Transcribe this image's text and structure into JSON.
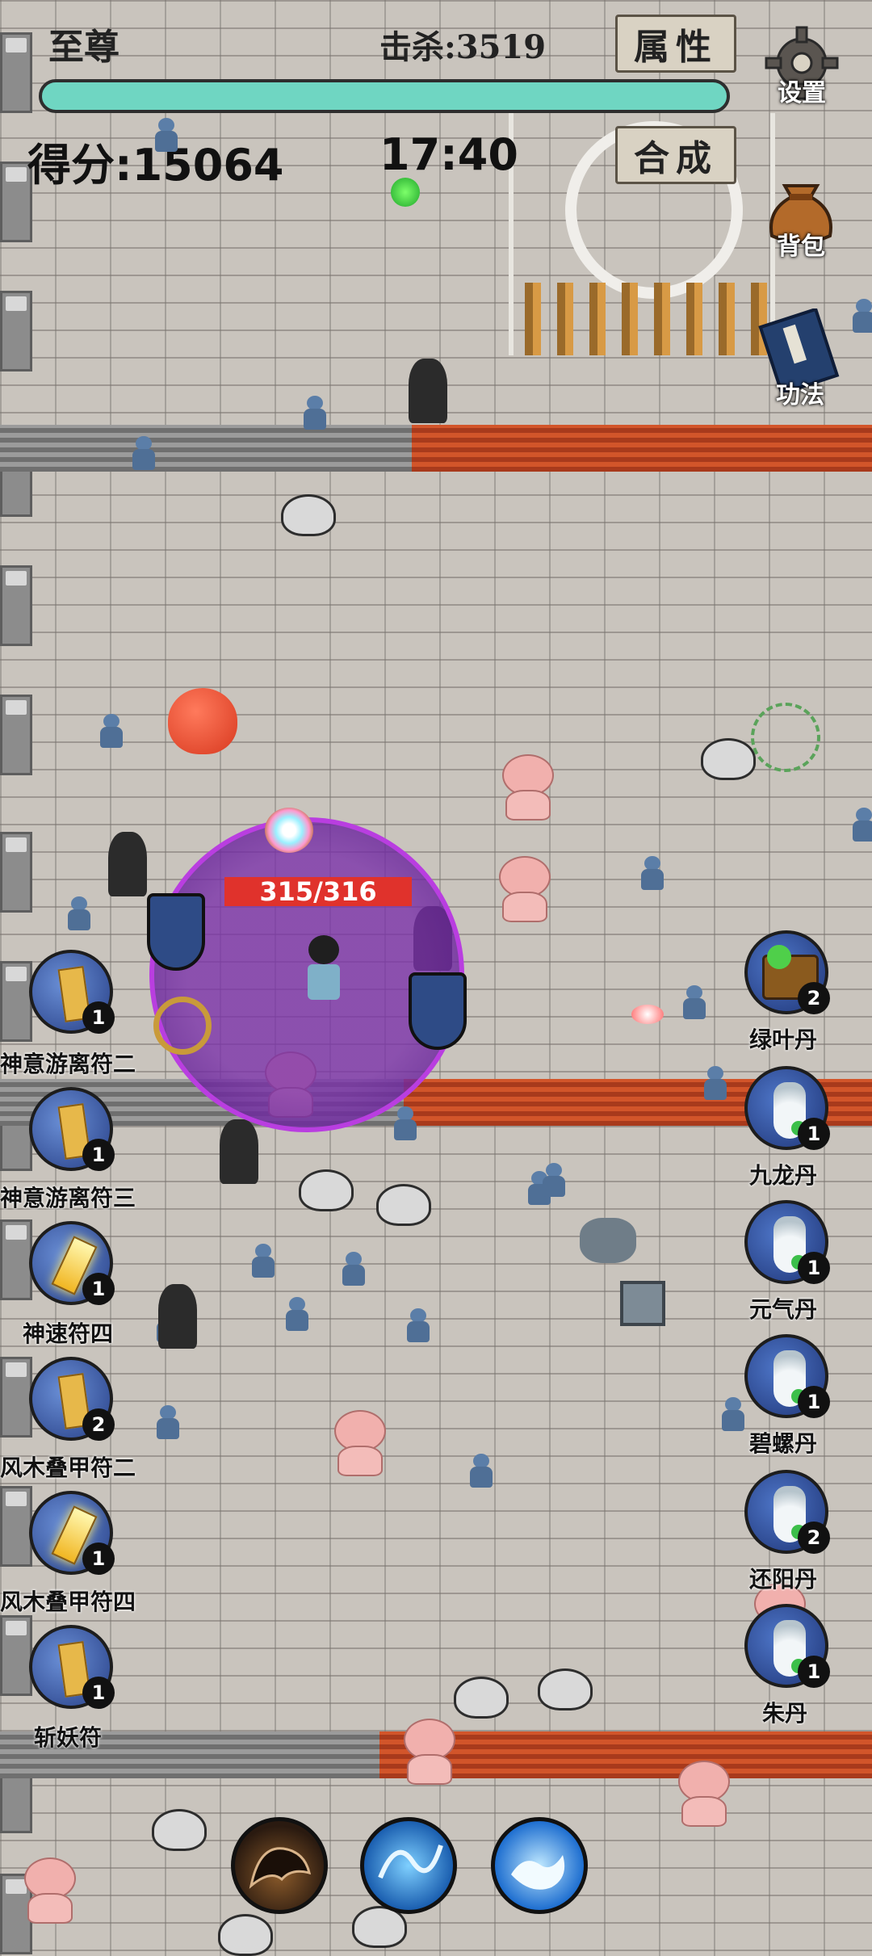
{
  "hud": {
    "rank_title": "至尊",
    "kills_label": "击杀:3519",
    "score_label": "得分:15064",
    "timer": "17:40",
    "hp_percent": 100
  },
  "menu": {
    "attributes_label": "属性",
    "synthesis_label": "合成",
    "settings_label": "设置",
    "backpack_label": "背包",
    "skills_label": "功法"
  },
  "player": {
    "hp_text": "315/316"
  },
  "talismans": [
    {
      "label": "神意游离符二",
      "count": "1"
    },
    {
      "label": "神意游离符三",
      "count": "1"
    },
    {
      "label": "神速符四",
      "count": "1"
    },
    {
      "label": "风木叠甲符二",
      "count": "2"
    },
    {
      "label": "风木叠甲符四",
      "count": "1"
    },
    {
      "label": "斩妖符",
      "count": "1"
    }
  ],
  "pills": [
    {
      "label": "绿叶丹",
      "count": "2"
    },
    {
      "label": "九龙丹",
      "count": "1"
    },
    {
      "label": "元气丹",
      "count": "1"
    },
    {
      "label": "碧螺丹",
      "count": "1"
    },
    {
      "label": "还阳丹",
      "count": "2"
    },
    {
      "label": "朱丹",
      "count": "1"
    }
  ],
  "abilities": [
    {
      "name": "shadow-beast-ability"
    },
    {
      "name": "water-whip-ability"
    },
    {
      "name": "wave-ability"
    }
  ],
  "colors": {
    "hp_bar": "#6fd6c2",
    "aura": "#7a30aa",
    "player_hp_bg": "#e0322c",
    "skill_bg": "#273f86"
  }
}
